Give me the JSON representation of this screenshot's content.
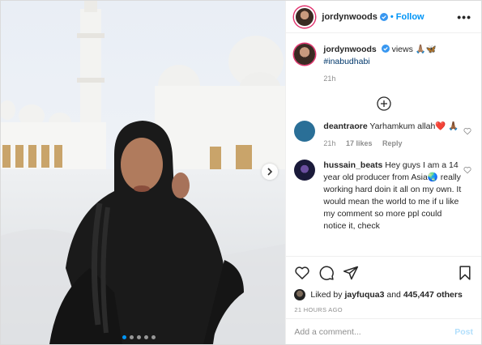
{
  "post": {
    "username": "jordynwoods",
    "follow_label": "Follow",
    "more_label": "•••",
    "carousel": {
      "slide_count": 5,
      "active_index": 0
    }
  },
  "caption": {
    "username": "jordynwoods",
    "text": "views 🙏🏽🦋",
    "hashtag": "#inabudhabi",
    "time": "21h"
  },
  "comments": [
    {
      "username": "deantraore",
      "text": "Yarhamkum allah❤️ 🙏🏾",
      "time": "21h",
      "likes": "17 likes",
      "reply": "Reply",
      "avatar_color": "#2a6f97"
    },
    {
      "username": "hussain_beats",
      "text": "Hey guys I am a 14 year old producer from Asia🌏 really working hard doin it all on my own. It would mean the world to me if u like my comment so more ppl could notice it, check",
      "avatar_color": "#1a1a3a"
    }
  ],
  "likes": {
    "prefix": "Liked by",
    "user": "jayfuqua3",
    "conjunction": "and",
    "others": "445,447 others"
  },
  "timestamp": "21 HOURS AGO",
  "comment_box": {
    "placeholder": "Add a comment...",
    "post_label": "Post"
  },
  "colors": {
    "link_blue": "#0095f6",
    "hashtag": "#00376b",
    "muted": "#8e8e8e",
    "story_ring": "#e1306c"
  },
  "icons": [
    "verified-icon",
    "more-icon",
    "add-comments-icon",
    "heart-icon",
    "comment-icon",
    "share-icon",
    "bookmark-icon",
    "next-arrow-icon"
  ]
}
